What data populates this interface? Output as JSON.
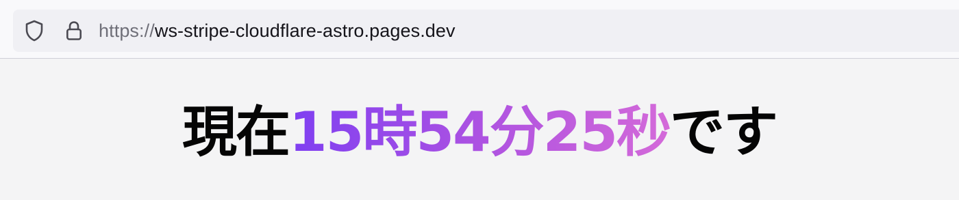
{
  "browser": {
    "url_scheme": "https://",
    "url_host": "ws-stripe-cloudflare-astro.pages.dev",
    "icons": [
      "shield-icon",
      "lock-icon"
    ]
  },
  "page": {
    "prefix": "現在",
    "time": "15時54分25秒",
    "suffix": "です",
    "colors": {
      "text": "#050505",
      "gradient_start": "#7f3ff1",
      "gradient_mid": "#b154e0",
      "gradient_end": "#d46ad9"
    }
  }
}
